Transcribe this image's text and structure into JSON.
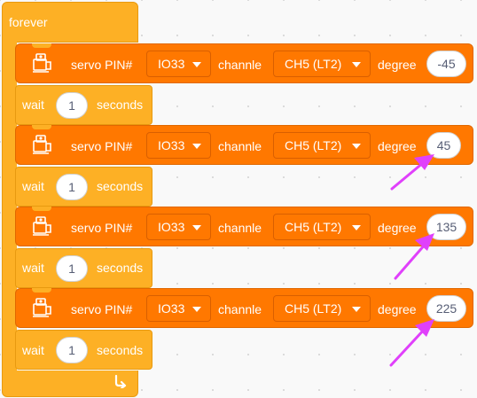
{
  "forever": {
    "label": "forever"
  },
  "servo_block": {
    "label_servo": "servo PIN#",
    "label_channel": "channle",
    "label_degree": "degree"
  },
  "wait_block": {
    "label_wait": "wait",
    "label_seconds": "seconds"
  },
  "sequence": [
    {
      "pin": "IO33",
      "channel": "CH5 (LT2)",
      "degree": "-45",
      "wait": "1"
    },
    {
      "pin": "IO33",
      "channel": "CH5 (LT2)",
      "degree": "45",
      "wait": "1"
    },
    {
      "pin": "IO33",
      "channel": "CH5 (LT2)",
      "degree": "135",
      "wait": "1"
    },
    {
      "pin": "IO33",
      "channel": "CH5 (LT2)",
      "degree": "225",
      "wait": "1"
    }
  ],
  "colors": {
    "control_block": "#fdb025",
    "servo_block": "#ff7800",
    "annotation_arrow": "#e040fb"
  }
}
